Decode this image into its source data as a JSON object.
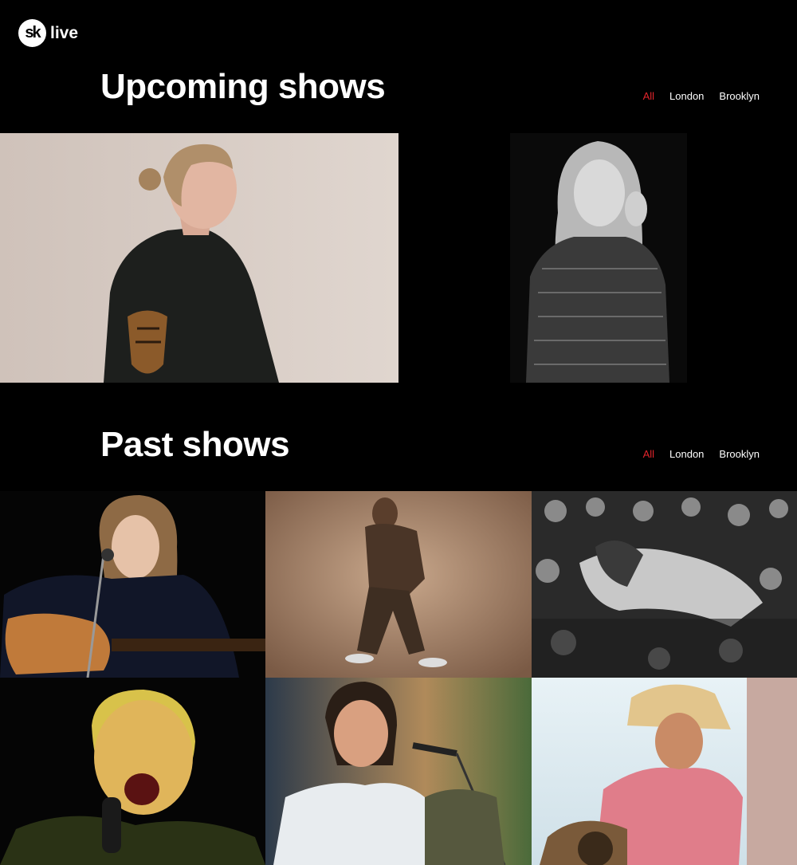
{
  "brand": {
    "logo_mark": "sk",
    "logo_text": "live"
  },
  "upcoming": {
    "title": "Upcoming shows",
    "filters": [
      {
        "label": "All",
        "active": true
      },
      {
        "label": "London",
        "active": false
      },
      {
        "label": "Brooklyn",
        "active": false
      }
    ]
  },
  "past": {
    "title": "Past shows",
    "filters": [
      {
        "label": "All",
        "active": true
      },
      {
        "label": "London",
        "active": false
      },
      {
        "label": "Brooklyn",
        "active": false
      }
    ]
  },
  "colors": {
    "background": "#000000",
    "accent": "#e2242b",
    "text": "#ffffff"
  }
}
